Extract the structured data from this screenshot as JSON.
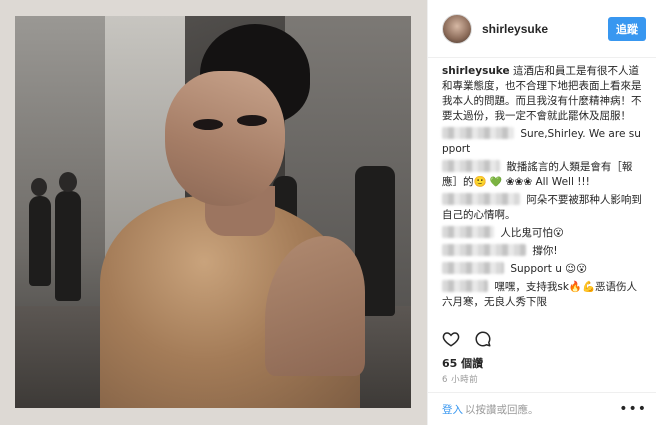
{
  "header": {
    "username": "shirleysuke",
    "follow_label": "追蹤"
  },
  "caption": {
    "user": "shirleysuke",
    "text": "這酒店和員工是有很不人道和專業態度，也不合理下地把表面上看來是我本人的問題。而且我沒有什麼精神病！不要太過份，我一定不會就此罷休及屈服！"
  },
  "comments": [
    {
      "blur_w": 72,
      "text": "Sure,Shirley. We are support",
      "emoji": ""
    },
    {
      "blur_w": 58,
      "text": "散播謠言的人類是會有［報應］的🙂",
      "emoji": "💚",
      "extra": "❀❀❀ All Well !!!"
    },
    {
      "blur_w": 78,
      "text": "阿朵不要被那种人影响到自己的心情啊。",
      "emoji": ""
    },
    {
      "blur_w": 52,
      "text": "人比鬼可怕😮",
      "emoji": ""
    },
    {
      "blur_w": 84,
      "text": "撐你!",
      "emoji": ""
    },
    {
      "blur_w": 62,
      "text": "Support u 😉😮",
      "emoji": ""
    },
    {
      "blur_w": 46,
      "text": "嘿嘿，支持我sk🔥💪恶语伤人六月寒，无良人秀下限",
      "emoji": ""
    }
  ],
  "stats": {
    "likes": "65 個讚",
    "time": "6 小時前"
  },
  "footer": {
    "login": "登入",
    "rest": "以按讚或回應。",
    "more": "•••"
  },
  "colors": {
    "accent": "#3897f0",
    "text": "#262626",
    "muted": "#999999"
  }
}
